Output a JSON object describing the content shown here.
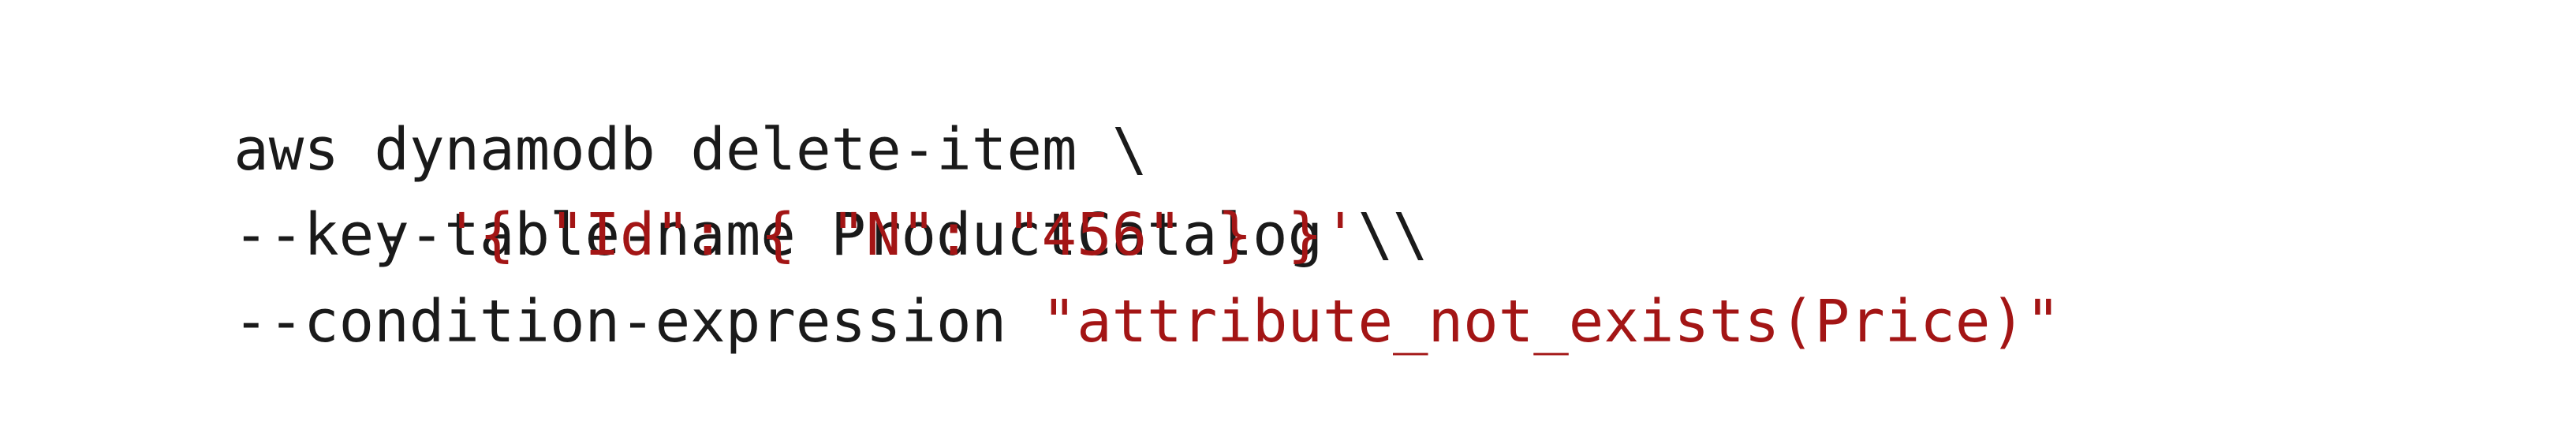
{
  "colors": {
    "background": "#ffffff",
    "text": "#1a1a1a",
    "string": "#a31515"
  },
  "code": {
    "line1": {
      "text": "aws dynamodb delete-item \\"
    },
    "line2": {
      "text": "--table-name ProductCatalog \\"
    },
    "line3": {
      "flag": "--key",
      "value": "'{ \"Id\": { \"N\": \"456\" } }'",
      "continuation": "\\"
    },
    "line4": {
      "flag": "--condition-expression",
      "value": "\"attribute_not_exists(Price)\""
    }
  }
}
